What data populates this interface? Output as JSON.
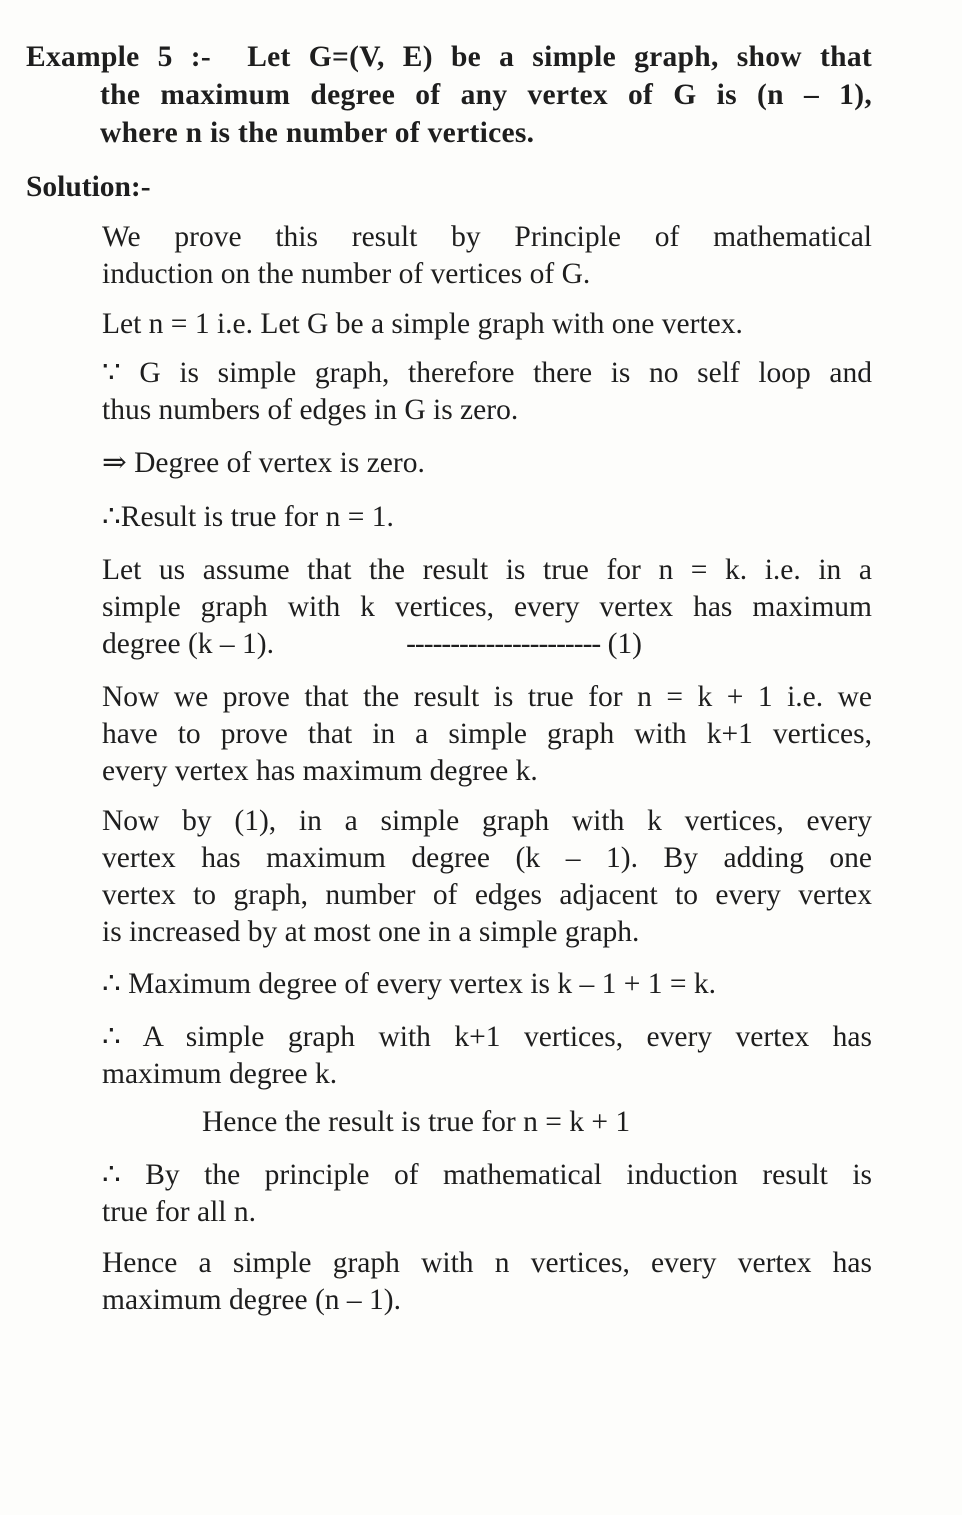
{
  "example": {
    "label": "Example 5 :-",
    "line1": "Let G=(V, E) be a simple graph, show that",
    "line2": "the maximum degree of any vertex of G is (n – 1),",
    "line3": "where n is the number of vertices."
  },
  "solution": {
    "heading": "Solution:-",
    "p1": [
      "We prove this result by Principle of mathematical",
      "induction on the number of vertices of G."
    ],
    "p2": [
      "Let n = 1 i.e. Let G be a simple graph with one vertex."
    ],
    "p3": [
      "∵ G is simple graph, therefore there is no self loop and",
      "thus numbers of edges in G is zero."
    ],
    "p4": [
      "⇒ Degree of vertex is zero."
    ],
    "p5": [
      "∴Result is true for n = 1."
    ],
    "p6": [
      "Let us assume that the result is true for n = k. i.e. in a",
      "simple graph with k vertices, every vertex has maximum"
    ],
    "p6_last": "degree (k – 1).",
    "p6_dashes": "----------------------",
    "p6_ref": "(1)",
    "p7": [
      "Now we prove that the result is true for n = k + 1 i.e. we",
      "have to prove that in a simple graph with k+1 vertices,",
      "every vertex has maximum degree k."
    ],
    "p8": [
      "Now by (1), in a simple graph with k vertices, every",
      "vertex has maximum degree (k – 1). By adding one",
      "vertex to graph, number of edges adjacent to every vertex",
      "is increased by at most one in a simple graph."
    ],
    "p9": [
      "∴ Maximum degree of every vertex is k – 1 + 1 = k."
    ],
    "p10": [
      "∴ A simple graph with k+1 vertices, every vertex has",
      "maximum degree k."
    ],
    "p11": "Hence the result is true for n = k + 1",
    "p12": [
      "∴ By the principle of mathematical induction result is",
      "true for all n."
    ],
    "p13": [
      "Hence a simple graph with n vertices, every vertex has",
      "maximum degree (n – 1)."
    ]
  }
}
